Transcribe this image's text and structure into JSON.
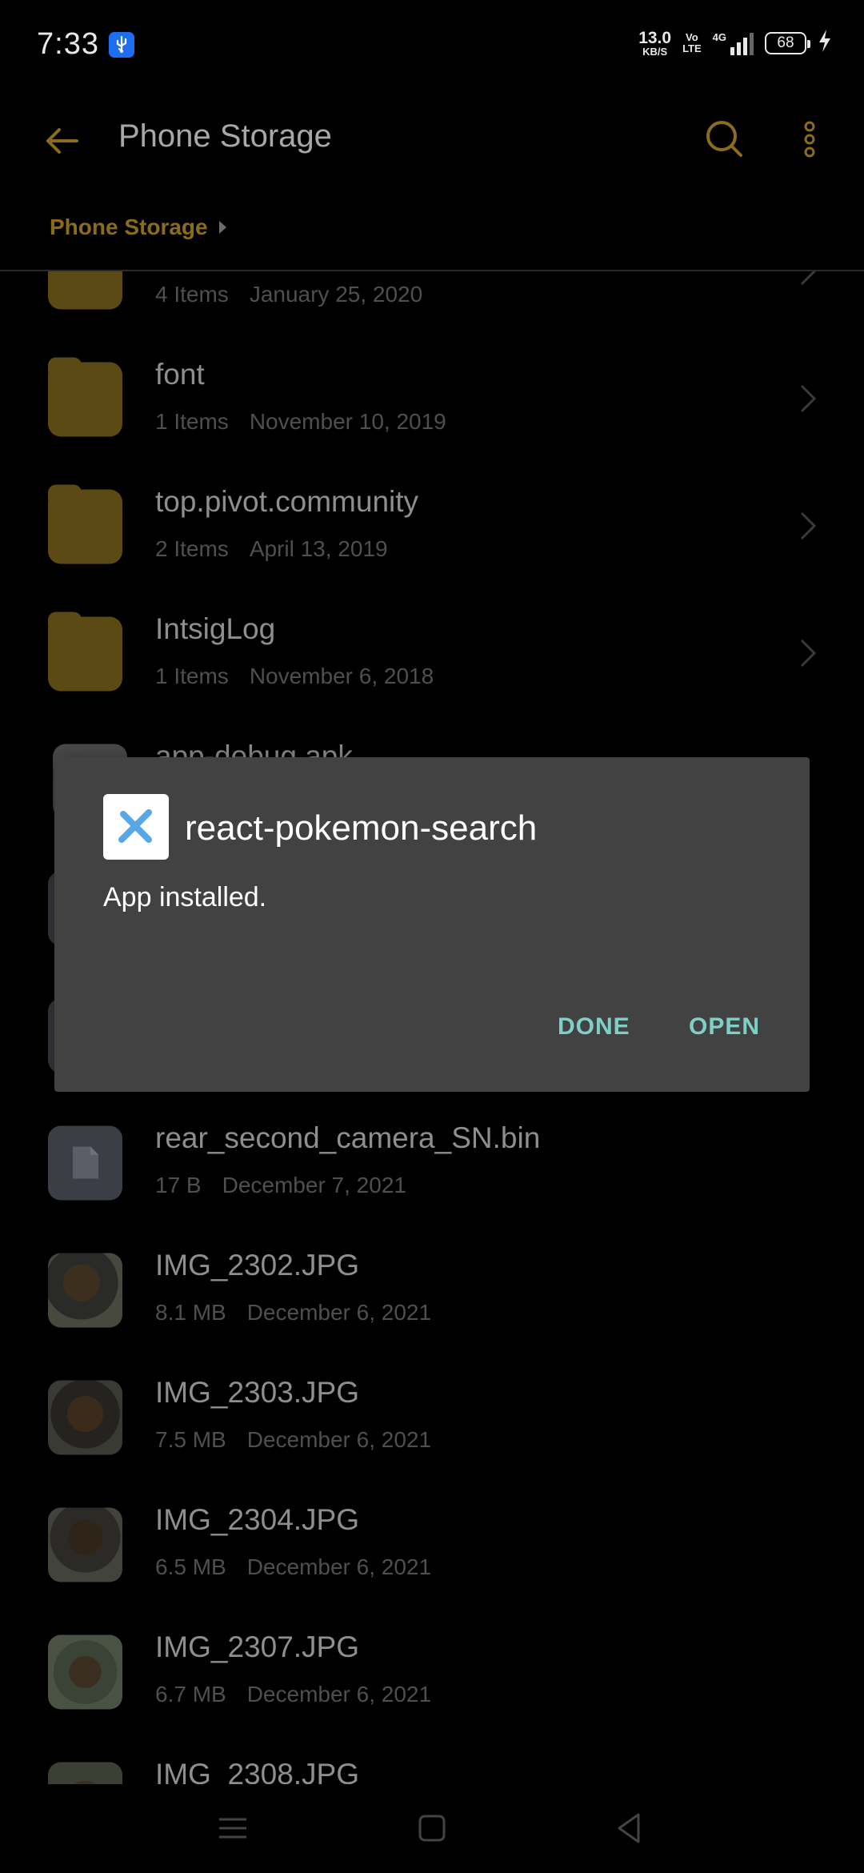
{
  "status": {
    "time": "7:33",
    "net_speed_value": "13.0",
    "net_speed_unit": "KB/S",
    "volte_line1": "Vo",
    "volte_line2": "LTE",
    "network_type": "4G",
    "battery": "68"
  },
  "appbar": {
    "title": "Phone Storage"
  },
  "breadcrumb": {
    "current": "Phone Storage"
  },
  "files": [
    {
      "name": "",
      "kind": "folder",
      "count": "4 Items",
      "date": "January 25, 2020"
    },
    {
      "name": "font",
      "kind": "folder",
      "count": "1 Items",
      "date": "November 10, 2019"
    },
    {
      "name": "top.pivot.community",
      "kind": "folder",
      "count": "2 Items",
      "date": "April 13, 2019"
    },
    {
      "name": "IntsigLog",
      "kind": "folder",
      "count": "1 Items",
      "date": "November 6, 2018"
    },
    {
      "name": "app-debug.apk",
      "kind": "apk",
      "count": "",
      "date": ""
    },
    {
      "name": "",
      "kind": "file",
      "count": "",
      "date": ""
    },
    {
      "name": "",
      "kind": "file",
      "count": "",
      "date": ""
    },
    {
      "name": "rear_second_camera_SN.bin",
      "kind": "file",
      "count": "17 B",
      "date": "December 7, 2021"
    },
    {
      "name": "IMG_2302.JPG",
      "kind": "image",
      "count": "8.1 MB",
      "date": "December 6, 2021"
    },
    {
      "name": "IMG_2303.JPG",
      "kind": "image",
      "count": "7.5 MB",
      "date": "December 6, 2021"
    },
    {
      "name": "IMG_2304.JPG",
      "kind": "image",
      "count": "6.5 MB",
      "date": "December 6, 2021"
    },
    {
      "name": "IMG_2307.JPG",
      "kind": "image",
      "count": "6.7 MB",
      "date": "December 6, 2021"
    },
    {
      "name": "IMG_2308.JPG",
      "kind": "image",
      "count": "",
      "date": ""
    }
  ],
  "dialog": {
    "app_name": "react-pokemon-search",
    "message": "App installed.",
    "done_label": "DONE",
    "open_label": "OPEN"
  },
  "colors": {
    "accent": "#8a6c1c",
    "dialog_bg": "#424242",
    "dialog_button": "#7fcfc6",
    "usb_badge": "#1e6ff0"
  }
}
